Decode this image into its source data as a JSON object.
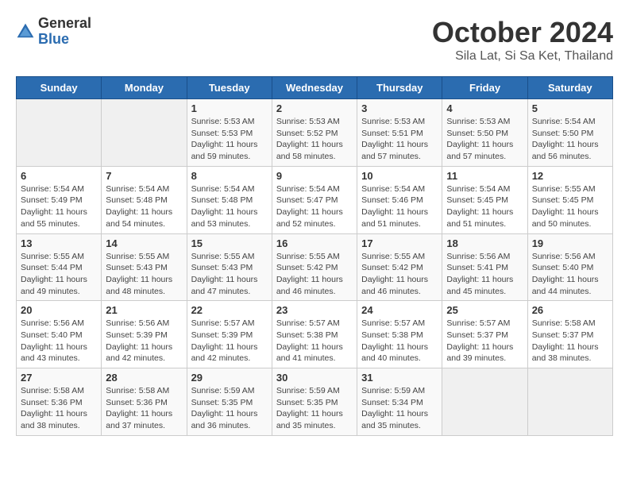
{
  "header": {
    "logo_general": "General",
    "logo_blue": "Blue",
    "month_title": "October 2024",
    "subtitle": "Sila Lat, Si Sa Ket, Thailand"
  },
  "weekdays": [
    "Sunday",
    "Monday",
    "Tuesday",
    "Wednesday",
    "Thursday",
    "Friday",
    "Saturday"
  ],
  "weeks": [
    [
      {
        "day": "",
        "info": ""
      },
      {
        "day": "",
        "info": ""
      },
      {
        "day": "1",
        "info": "Sunrise: 5:53 AM\nSunset: 5:53 PM\nDaylight: 11 hours and 59 minutes."
      },
      {
        "day": "2",
        "info": "Sunrise: 5:53 AM\nSunset: 5:52 PM\nDaylight: 11 hours and 58 minutes."
      },
      {
        "day": "3",
        "info": "Sunrise: 5:53 AM\nSunset: 5:51 PM\nDaylight: 11 hours and 57 minutes."
      },
      {
        "day": "4",
        "info": "Sunrise: 5:53 AM\nSunset: 5:50 PM\nDaylight: 11 hours and 57 minutes."
      },
      {
        "day": "5",
        "info": "Sunrise: 5:54 AM\nSunset: 5:50 PM\nDaylight: 11 hours and 56 minutes."
      }
    ],
    [
      {
        "day": "6",
        "info": "Sunrise: 5:54 AM\nSunset: 5:49 PM\nDaylight: 11 hours and 55 minutes."
      },
      {
        "day": "7",
        "info": "Sunrise: 5:54 AM\nSunset: 5:48 PM\nDaylight: 11 hours and 54 minutes."
      },
      {
        "day": "8",
        "info": "Sunrise: 5:54 AM\nSunset: 5:48 PM\nDaylight: 11 hours and 53 minutes."
      },
      {
        "day": "9",
        "info": "Sunrise: 5:54 AM\nSunset: 5:47 PM\nDaylight: 11 hours and 52 minutes."
      },
      {
        "day": "10",
        "info": "Sunrise: 5:54 AM\nSunset: 5:46 PM\nDaylight: 11 hours and 51 minutes."
      },
      {
        "day": "11",
        "info": "Sunrise: 5:54 AM\nSunset: 5:45 PM\nDaylight: 11 hours and 51 minutes."
      },
      {
        "day": "12",
        "info": "Sunrise: 5:55 AM\nSunset: 5:45 PM\nDaylight: 11 hours and 50 minutes."
      }
    ],
    [
      {
        "day": "13",
        "info": "Sunrise: 5:55 AM\nSunset: 5:44 PM\nDaylight: 11 hours and 49 minutes."
      },
      {
        "day": "14",
        "info": "Sunrise: 5:55 AM\nSunset: 5:43 PM\nDaylight: 11 hours and 48 minutes."
      },
      {
        "day": "15",
        "info": "Sunrise: 5:55 AM\nSunset: 5:43 PM\nDaylight: 11 hours and 47 minutes."
      },
      {
        "day": "16",
        "info": "Sunrise: 5:55 AM\nSunset: 5:42 PM\nDaylight: 11 hours and 46 minutes."
      },
      {
        "day": "17",
        "info": "Sunrise: 5:55 AM\nSunset: 5:42 PM\nDaylight: 11 hours and 46 minutes."
      },
      {
        "day": "18",
        "info": "Sunrise: 5:56 AM\nSunset: 5:41 PM\nDaylight: 11 hours and 45 minutes."
      },
      {
        "day": "19",
        "info": "Sunrise: 5:56 AM\nSunset: 5:40 PM\nDaylight: 11 hours and 44 minutes."
      }
    ],
    [
      {
        "day": "20",
        "info": "Sunrise: 5:56 AM\nSunset: 5:40 PM\nDaylight: 11 hours and 43 minutes."
      },
      {
        "day": "21",
        "info": "Sunrise: 5:56 AM\nSunset: 5:39 PM\nDaylight: 11 hours and 42 minutes."
      },
      {
        "day": "22",
        "info": "Sunrise: 5:57 AM\nSunset: 5:39 PM\nDaylight: 11 hours and 42 minutes."
      },
      {
        "day": "23",
        "info": "Sunrise: 5:57 AM\nSunset: 5:38 PM\nDaylight: 11 hours and 41 minutes."
      },
      {
        "day": "24",
        "info": "Sunrise: 5:57 AM\nSunset: 5:38 PM\nDaylight: 11 hours and 40 minutes."
      },
      {
        "day": "25",
        "info": "Sunrise: 5:57 AM\nSunset: 5:37 PM\nDaylight: 11 hours and 39 minutes."
      },
      {
        "day": "26",
        "info": "Sunrise: 5:58 AM\nSunset: 5:37 PM\nDaylight: 11 hours and 38 minutes."
      }
    ],
    [
      {
        "day": "27",
        "info": "Sunrise: 5:58 AM\nSunset: 5:36 PM\nDaylight: 11 hours and 38 minutes."
      },
      {
        "day": "28",
        "info": "Sunrise: 5:58 AM\nSunset: 5:36 PM\nDaylight: 11 hours and 37 minutes."
      },
      {
        "day": "29",
        "info": "Sunrise: 5:59 AM\nSunset: 5:35 PM\nDaylight: 11 hours and 36 minutes."
      },
      {
        "day": "30",
        "info": "Sunrise: 5:59 AM\nSunset: 5:35 PM\nDaylight: 11 hours and 35 minutes."
      },
      {
        "day": "31",
        "info": "Sunrise: 5:59 AM\nSunset: 5:34 PM\nDaylight: 11 hours and 35 minutes."
      },
      {
        "day": "",
        "info": ""
      },
      {
        "day": "",
        "info": ""
      }
    ]
  ]
}
